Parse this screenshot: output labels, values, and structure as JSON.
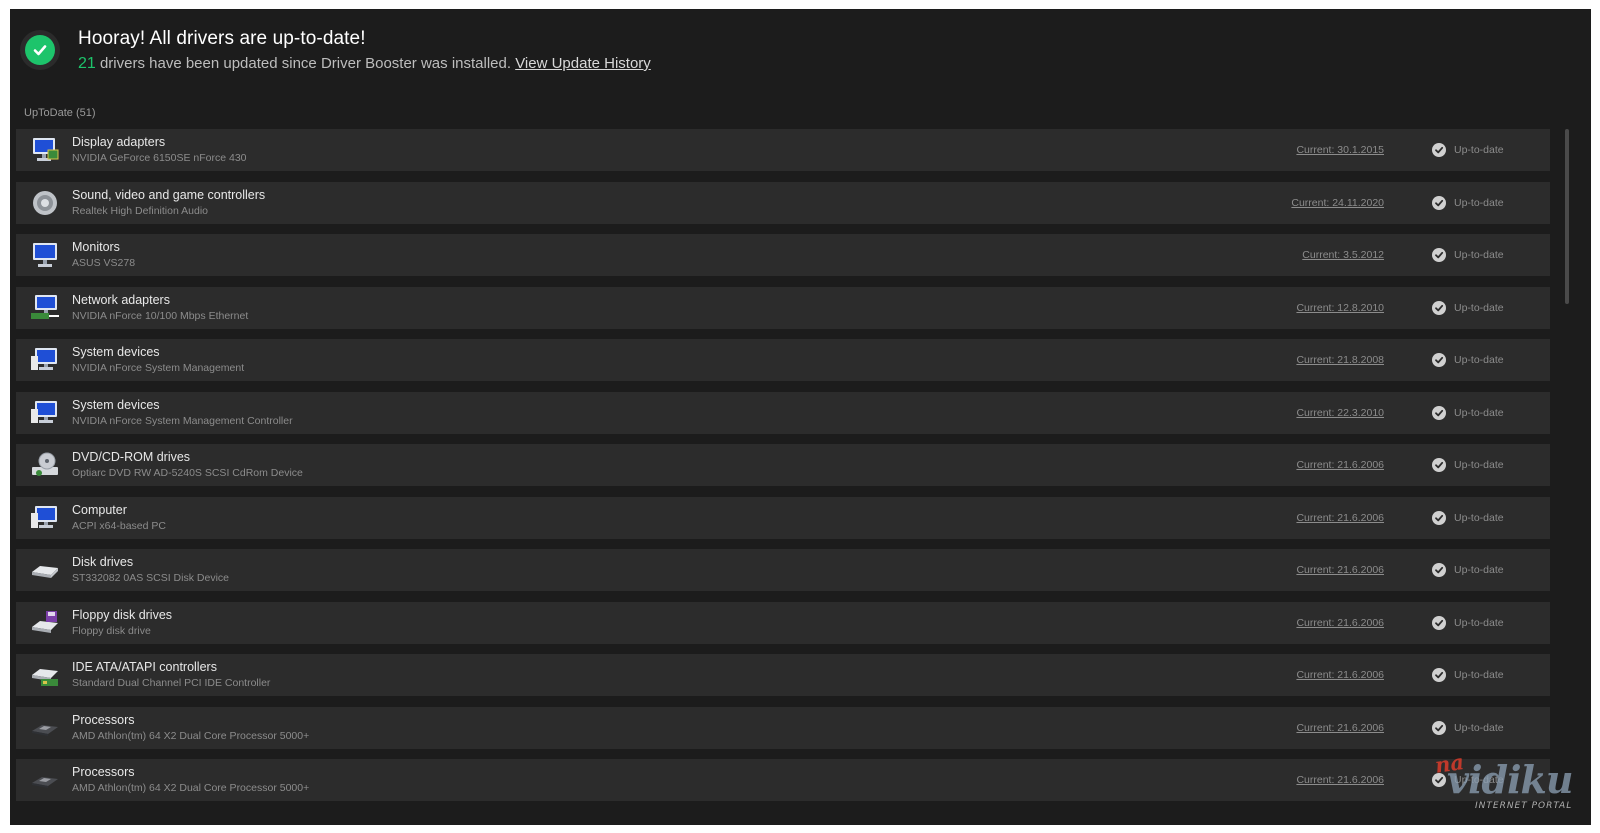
{
  "header": {
    "title": "Hooray! All drivers are up-to-date!",
    "updated_count": "21",
    "updated_text": " drivers have been updated since Driver Booster was installed. ",
    "history_link": "View Update History"
  },
  "section": {
    "label": "UpToDate (51)"
  },
  "rows": [
    {
      "icon": "display-adapter-icon",
      "category": "Display adapters",
      "device": "NVIDIA GeForce 6150SE nForce 430",
      "current": "Current: 30.1.2015",
      "status": "Up-to-date"
    },
    {
      "icon": "speaker-icon",
      "category": "Sound, video and game controllers",
      "device": "Realtek High Definition Audio",
      "current": "Current: 24.11.2020",
      "status": "Up-to-date"
    },
    {
      "icon": "monitor-icon",
      "category": "Monitors",
      "device": "ASUS VS278",
      "current": "Current: 3.5.2012",
      "status": "Up-to-date"
    },
    {
      "icon": "network-adapter-icon",
      "category": "Network adapters",
      "device": "NVIDIA nForce 10/100 Mbps Ethernet",
      "current": "Current: 12.8.2010",
      "status": "Up-to-date"
    },
    {
      "icon": "system-device-icon",
      "category": "System devices",
      "device": "NVIDIA nForce System Management",
      "current": "Current: 21.8.2008",
      "status": "Up-to-date"
    },
    {
      "icon": "system-device-icon",
      "category": "System devices",
      "device": "NVIDIA nForce System Management Controller",
      "current": "Current: 22.3.2010",
      "status": "Up-to-date"
    },
    {
      "icon": "dvd-drive-icon",
      "category": "DVD/CD-ROM drives",
      "device": "Optiarc DVD RW AD-5240S SCSI CdRom Device",
      "current": "Current: 21.6.2006",
      "status": "Up-to-date"
    },
    {
      "icon": "computer-icon",
      "category": "Computer",
      "device": "ACPI x64-based PC",
      "current": "Current: 21.6.2006",
      "status": "Up-to-date"
    },
    {
      "icon": "disk-drive-icon",
      "category": "Disk drives",
      "device": "ST332082 0AS SCSI Disk Device",
      "current": "Current: 21.6.2006",
      "status": "Up-to-date"
    },
    {
      "icon": "floppy-drive-icon",
      "category": "Floppy disk drives",
      "device": "Floppy disk drive",
      "current": "Current: 21.6.2006",
      "status": "Up-to-date"
    },
    {
      "icon": "ide-controller-icon",
      "category": "IDE ATA/ATAPI controllers",
      "device": "Standard Dual Channel PCI IDE Controller",
      "current": "Current: 21.6.2006",
      "status": "Up-to-date"
    },
    {
      "icon": "processor-icon",
      "category": "Processors",
      "device": "AMD Athlon(tm) 64 X2 Dual Core Processor 5000+",
      "current": "Current: 21.6.2006",
      "status": "Up-to-date"
    },
    {
      "icon": "processor-icon",
      "category": "Processors",
      "device": "AMD Athlon(tm) 64 X2 Dual Core Processor 5000+",
      "current": "Current: 21.6.2006",
      "status": "Up-to-date"
    }
  ],
  "watermark": {
    "na": "na",
    "name": "vidiku",
    "tagline": "INTERNET PORTAL"
  },
  "colors": {
    "background": "#1c1c1c",
    "row": "#2c2c2c",
    "accent_green": "#1dc46b"
  }
}
